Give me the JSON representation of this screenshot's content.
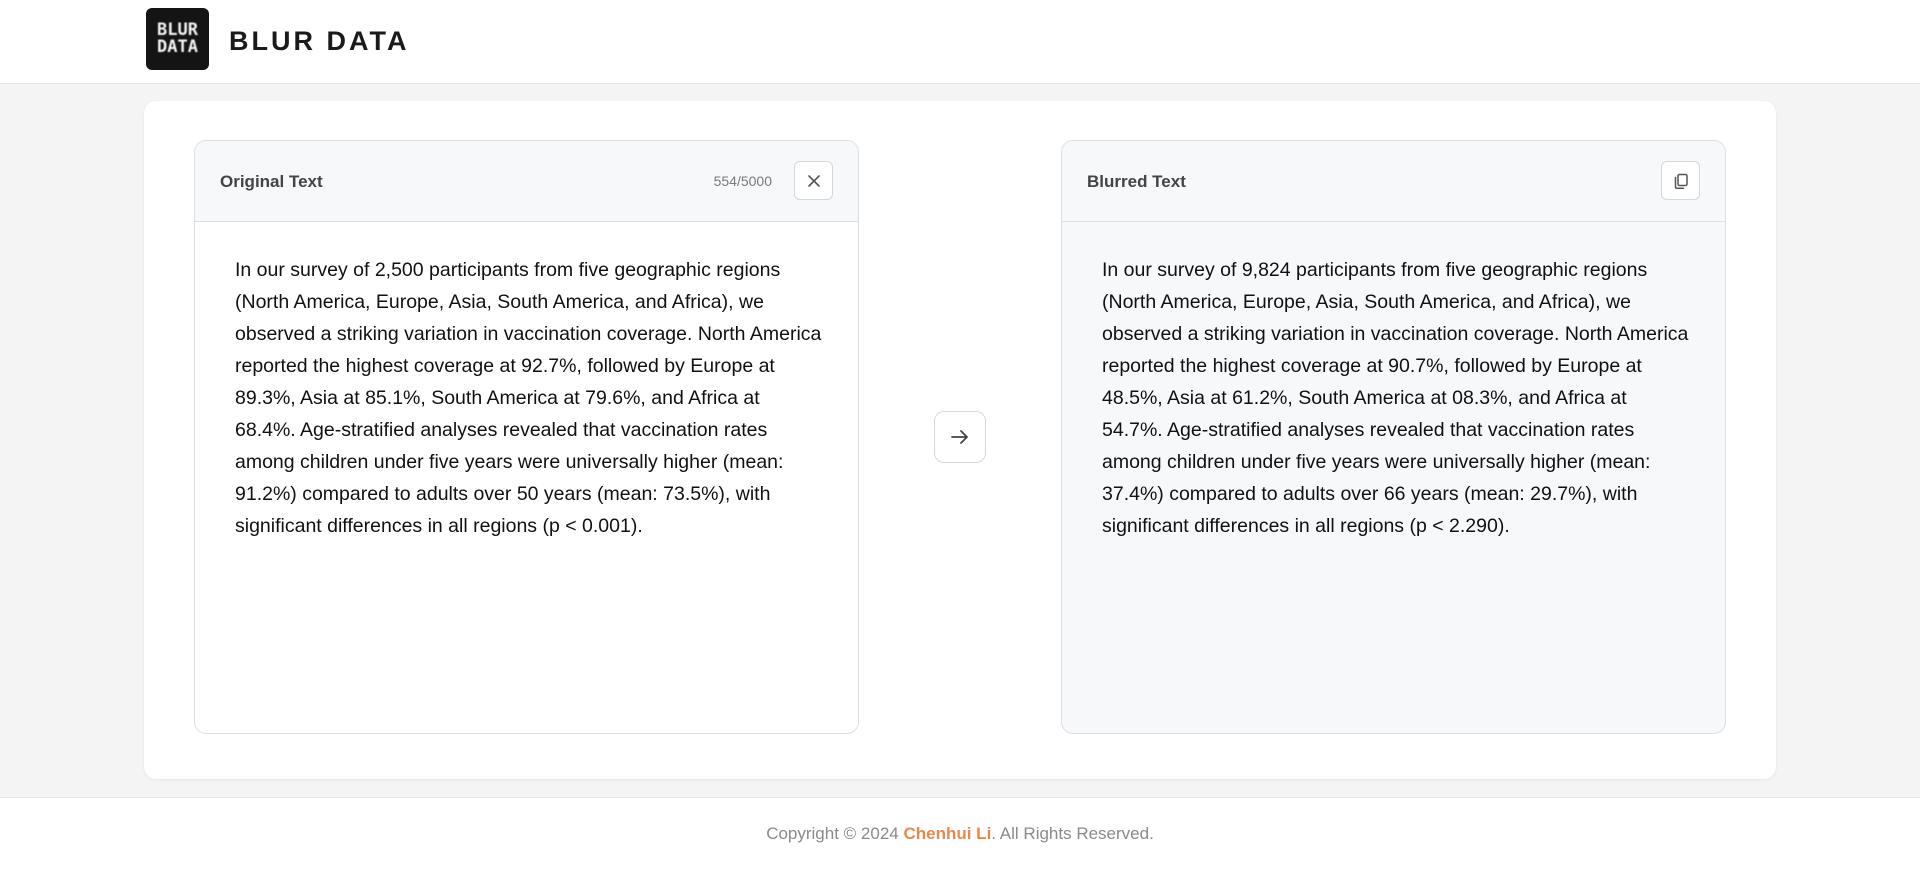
{
  "header": {
    "logo_text_top": "BLUR",
    "logo_text_bottom": "DATA",
    "brand": "BLUR DATA"
  },
  "original": {
    "title": "Original Text",
    "counter": "554/5000",
    "text": "In our survey of 2,500 participants from five geographic regions (North America, Europe, Asia, South America, and Africa), we observed a striking variation in vaccination coverage. North America reported the highest coverage at 92.7%, followed by Europe at 89.3%, Asia at 85.1%, South America at 79.6%, and Africa at 68.4%. Age-stratified analyses revealed that vaccination rates among children under five years were universally higher (mean: 91.2%) compared to adults over 50 years (mean: 73.5%), with significant differences in all regions (p < 0.001)."
  },
  "blurred": {
    "title": "Blurred Text",
    "text": "In our survey of 9,824 participants from five geographic regions (North America, Europe, Asia, South America, and Africa), we observed a striking variation in vaccination coverage. North America reported the highest coverage at 90.7%, followed by Europe at 48.5%, Asia at 61.2%, South America at 08.3%, and Africa at 54.7%. Age-stratified analyses revealed that vaccination rates among children under five years were universally higher (mean: 37.4%) compared to adults over 66 years (mean: 29.7%), with significant differences in all regions (p < 2.290)."
  },
  "icons": {
    "clear": "close-icon",
    "copy": "copy-icon",
    "convert": "arrow-right-icon"
  },
  "footer": {
    "prefix": "Copyright © 2024 ",
    "author": "Chenhui Li",
    "suffix": ". All Rights Reserved."
  },
  "colors": {
    "accent": "#e8894a",
    "panel_head_bg": "#f7f8fa",
    "page_bg": "#f4f4f4"
  }
}
